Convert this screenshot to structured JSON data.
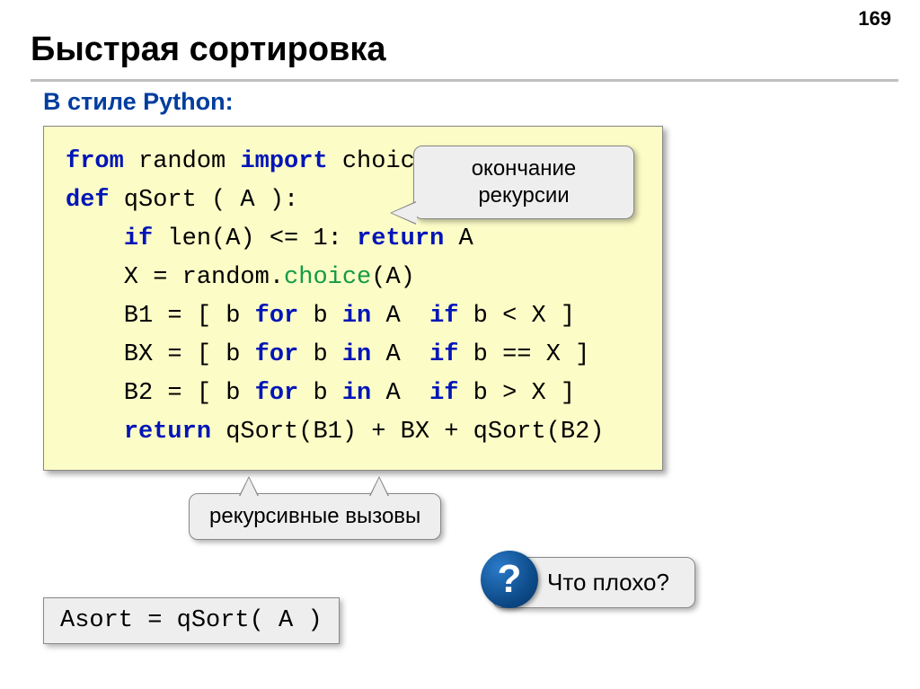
{
  "page_number": "169",
  "title": "Быстрая сортировка",
  "subtitle": "В стиле Python:",
  "code": {
    "l1_from": "from",
    "l1_random": " random ",
    "l1_import": "import",
    "l1_choice": " choice",
    "l2_def": "def",
    "l2_rest": " qSort ( A ):",
    "l3_pre": "    ",
    "l3_if": "if",
    "l3_mid": " len(A) <= 1: ",
    "l3_return": "return",
    "l3_end": " A",
    "l4": "    X = random.",
    "l4_choice": "choice",
    "l4_end": "(A)",
    "l5_pre": "    B1 = [ b ",
    "l5_for": "for",
    "l5_mid1": " b ",
    "l5_in": "in",
    "l5_mid2": " A  ",
    "l5_if": "if",
    "l5_end": " b < X ]",
    "l6_pre": "    BX = [ b ",
    "l6_for": "for",
    "l6_mid1": " b ",
    "l6_in": "in",
    "l6_mid2": " A  ",
    "l6_if": "if",
    "l6_end": " b == X ]",
    "l7_pre": "    B2 = [ b ",
    "l7_for": "for",
    "l7_mid1": " b ",
    "l7_in": "in",
    "l7_mid2": " A  ",
    "l7_if": "if",
    "l7_end": " b > X ]",
    "l8_pre": "    ",
    "l8_return": "return",
    "l8_end": " qSort(B1) + BX + qSort(B2)"
  },
  "callouts": {
    "recursion_end_l1": "окончание",
    "recursion_end_l2": "рекурсии",
    "recursive_calls": "рекурсивные вызовы",
    "question_text": "Что плохо?",
    "question_mark": "?"
  },
  "asort": "Asort = qSort( A )"
}
